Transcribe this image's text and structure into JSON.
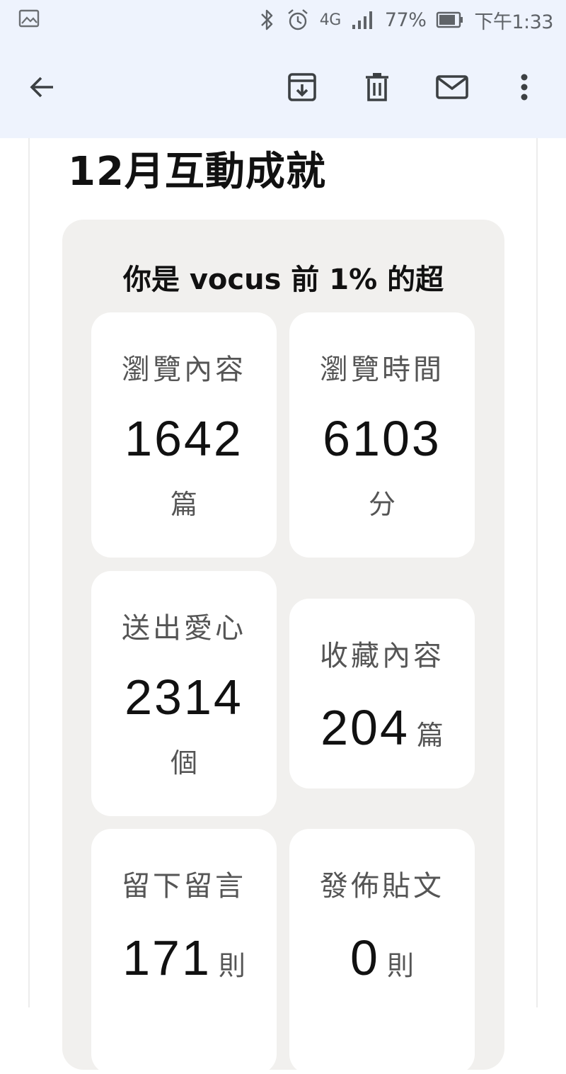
{
  "status_bar": {
    "battery_percent": "77%",
    "network": "4G",
    "time": "下午1:33"
  },
  "icons": {
    "gallery": "image-icon",
    "bluetooth": "bluetooth-icon",
    "alarm": "alarm-icon",
    "signal": "signal-icon",
    "battery": "battery-icon",
    "back": "back-arrow-icon",
    "archive": "archive-icon",
    "delete": "trash-icon",
    "mail": "mail-icon",
    "more": "more-vert-icon"
  },
  "email": {
    "headline": "12月互動成就",
    "panel_title": "你是 vocus 前 1% 的超",
    "stats": [
      {
        "label": "瀏覽內容",
        "value": "1642",
        "unit": "篇"
      },
      {
        "label": "瀏覽時間",
        "value": "6103",
        "unit": "分"
      },
      {
        "label": "送出愛心",
        "value": "2314",
        "unit": "個"
      },
      {
        "label": "收藏內容",
        "value": "204",
        "unit": "篇"
      },
      {
        "label": "留下留言",
        "value": "171",
        "unit": "則"
      },
      {
        "label": "發佈貼文",
        "value": "0",
        "unit": "則"
      }
    ]
  },
  "colors": {
    "top_bar_bg": "#eef3fd",
    "panel_bg": "#f1f0ee",
    "card_bg": "#ffffff",
    "icon_color": "#3c4043"
  }
}
